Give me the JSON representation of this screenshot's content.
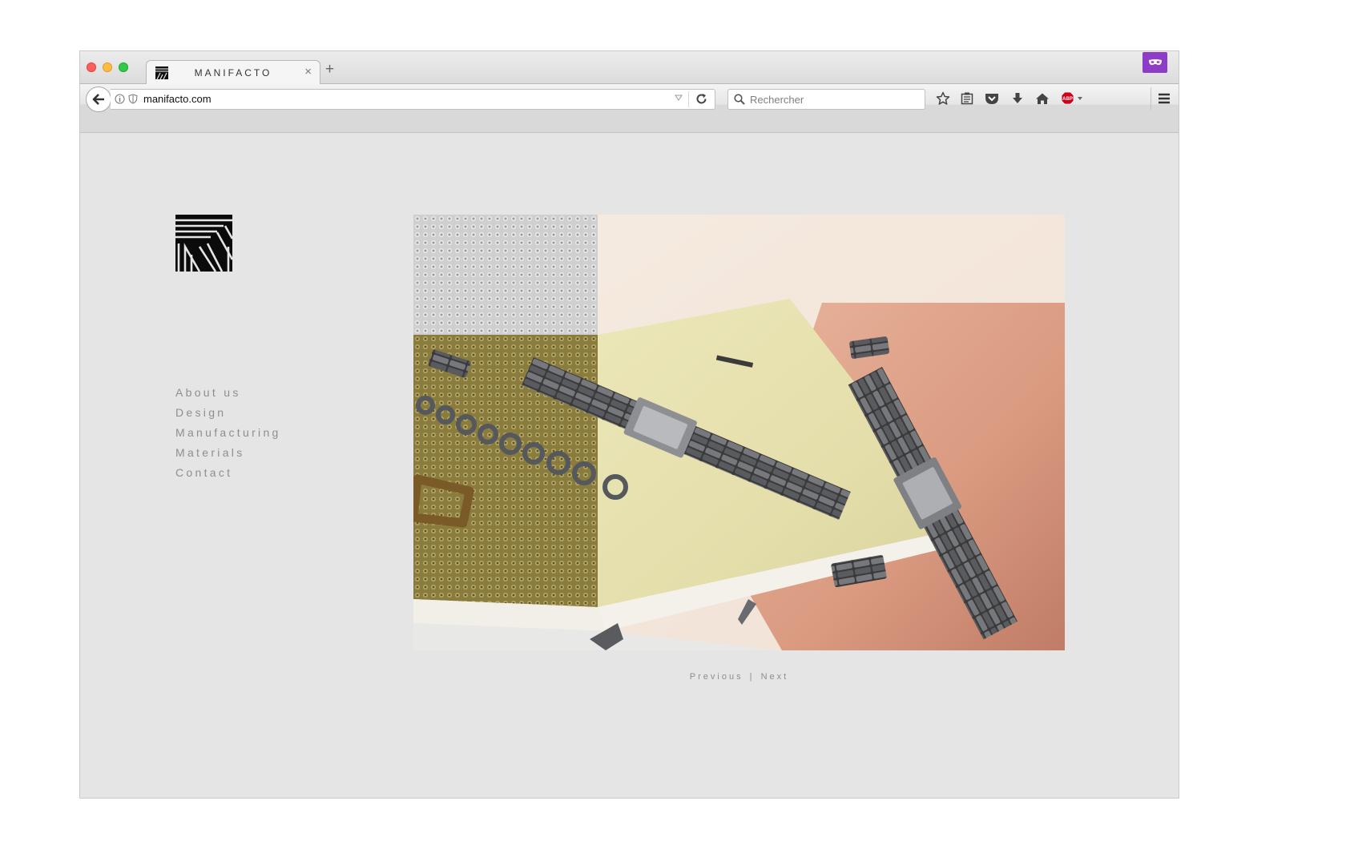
{
  "browser": {
    "tab": {
      "title": "MANIFACTO",
      "close_glyph": "×"
    },
    "new_tab_glyph": "+",
    "url": "manifacto.com",
    "search_placeholder": "Rechercher",
    "toolbar_icons": [
      "bookmark-star-icon",
      "reading-list-icon",
      "pocket-icon",
      "download-icon",
      "home-icon",
      "adblock-plus-icon",
      "hamburger-menu-icon"
    ],
    "adblock_label": "ABP",
    "accent_colors": {
      "private_mask": "#8d3cc7",
      "adblock": "#d0021b"
    }
  },
  "site": {
    "nav": [
      "About us",
      "Design",
      "Manufacturing",
      "Materials",
      "Contact"
    ],
    "pager": {
      "previous": "Previous",
      "separator": "|",
      "next": "Next"
    }
  }
}
